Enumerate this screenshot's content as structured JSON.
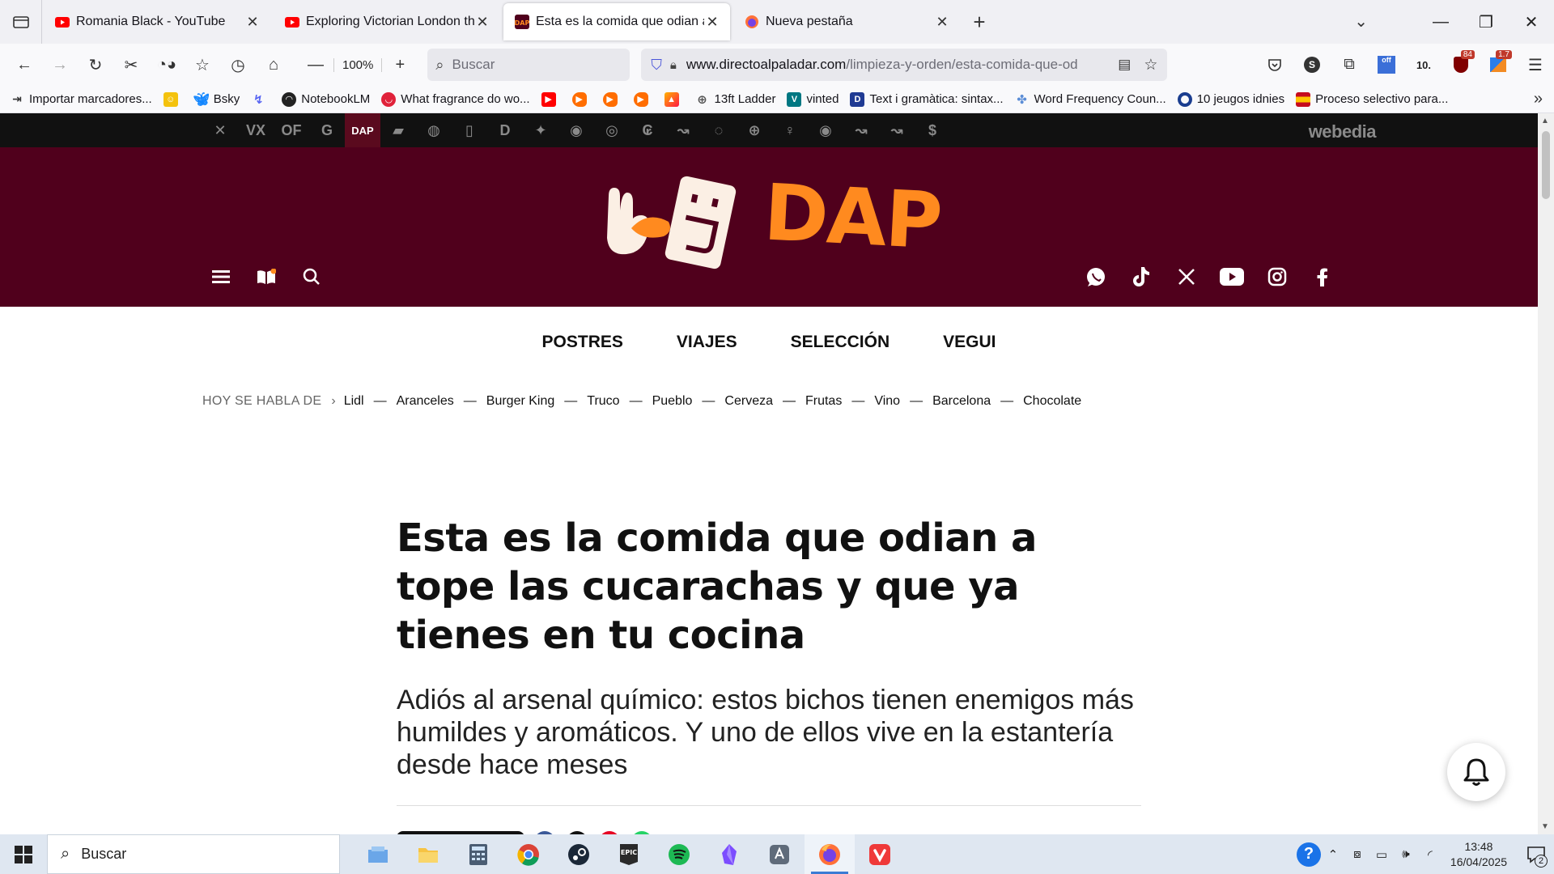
{
  "browser": {
    "tabs": [
      {
        "title": "Romania Black - YouTube",
        "favicon": "youtube-icon",
        "active": false
      },
      {
        "title": "Exploring Victorian London thro",
        "favicon": "youtube-icon",
        "active": false
      },
      {
        "title": "Esta es la comida que odian a t",
        "favicon": "dap-icon",
        "active": true
      },
      {
        "title": "Nueva pestaña",
        "favicon": "firefox-icon",
        "active": false
      }
    ],
    "zoom": "100%",
    "search_placeholder": "Buscar",
    "url_host": "www.directoalpaladar.com",
    "url_path": "/limpieza-y-orden/esta-comida-que-od",
    "extensions": [
      {
        "icon": "pocket-icon",
        "badge": ""
      },
      {
        "icon": "s-extension-icon",
        "badge": ""
      },
      {
        "icon": "extensions-icon",
        "badge": ""
      },
      {
        "icon": "off-extension-icon",
        "badge": "off"
      },
      {
        "icon": "ten-extension-icon",
        "badge": ""
      },
      {
        "icon": "ublock-icon",
        "badge": "84"
      },
      {
        "icon": "streak-extension-icon",
        "badge": "1.7"
      }
    ]
  },
  "bookmarks": [
    {
      "label": "Importar marcadores...",
      "icon": "import-icon",
      "color": "#444444"
    },
    {
      "label": "",
      "icon": "yellow-bookmark-icon",
      "color": "#f4c20d"
    },
    {
      "label": "Bsky",
      "icon": "butterfly-icon",
      "color": "#1185fe"
    },
    {
      "label": "",
      "icon": "vivaldi-like-icon",
      "color": "#5865f2"
    },
    {
      "label": "NotebookLM",
      "icon": "notebooklm-icon",
      "color": "#222222"
    },
    {
      "label": "What fragrance do wo...",
      "icon": "red-circle-icon",
      "color": "#e0223a"
    },
    {
      "label": "",
      "icon": "youtube-icon",
      "color": "#ff0000"
    },
    {
      "label": "",
      "icon": "orange-play-icon",
      "color": "#ff6d00"
    },
    {
      "label": "",
      "icon": "orange-play-icon",
      "color": "#ff6d00"
    },
    {
      "label": "",
      "icon": "orange-play-icon",
      "color": "#ff6d00"
    },
    {
      "label": "",
      "icon": "mountain-icon",
      "color": "#ff3d00"
    },
    {
      "label": "13ft Ladder",
      "icon": "globe-icon",
      "color": "#555555"
    },
    {
      "label": "vinted",
      "icon": "vinted-icon",
      "color": "#007782"
    },
    {
      "label": "Text i gramàtica: sintax...",
      "icon": "d-book-icon",
      "color": "#1f3a93"
    },
    {
      "label": "Word Frequency Coun...",
      "icon": "tree-icon",
      "color": "#5b8dd6"
    },
    {
      "label": "10 jeugos idnies",
      "icon": "blue-ring-icon",
      "color": "#1a3d8f"
    },
    {
      "label": "Proceso selectivo para...",
      "icon": "spain-seal-icon",
      "color": "#c8a000"
    }
  ],
  "page": {
    "network_brand": "webedia",
    "network_sites": [
      "✕",
      "VX",
      "OF",
      "G",
      "DAP",
      "▰",
      "◍",
      "▯",
      "D",
      "✦",
      "◉",
      "◎",
      "₢",
      "↝",
      "◌",
      "⊕",
      "♀",
      "◉",
      "↝",
      "↝",
      "$"
    ],
    "logo_text": "DAP",
    "categories": [
      "POSTRES",
      "VIAJES",
      "SELECCIÓN",
      "VEGUI"
    ],
    "trending_label": "HOY SE HABLA DE",
    "trending": [
      "Lidl",
      "Aranceles",
      "Burger King",
      "Truco",
      "Pueblo",
      "Cerveza",
      "Frutas",
      "Vino",
      "Barcelona",
      "Chocolate"
    ],
    "headline": "Esta es la comida que odian a tope las cucarachas y que ya tienes en tu cocina",
    "subtitle": "Adiós al arsenal químico: estos bichos tienen enemigos más humildes y aromáticos. Y uno de ellos vive en la estantería desde hace meses",
    "colors": {
      "brand_dark": "#50001c",
      "brand_orange": "#ff8a1f",
      "logo_cream": "#fbefe4"
    }
  },
  "taskbar": {
    "search_placeholder": "Buscar",
    "apps": [
      "file-explorer-alt-icon",
      "folder-icon",
      "calculator-icon",
      "chrome-icon",
      "steam-icon",
      "epic-games-icon",
      "spotify-icon",
      "obsidian-icon",
      "ai-app-icon",
      "firefox-icon",
      "vivaldi-icon"
    ],
    "time": "13:48",
    "date": "16/04/2025",
    "notification_count": "2"
  }
}
